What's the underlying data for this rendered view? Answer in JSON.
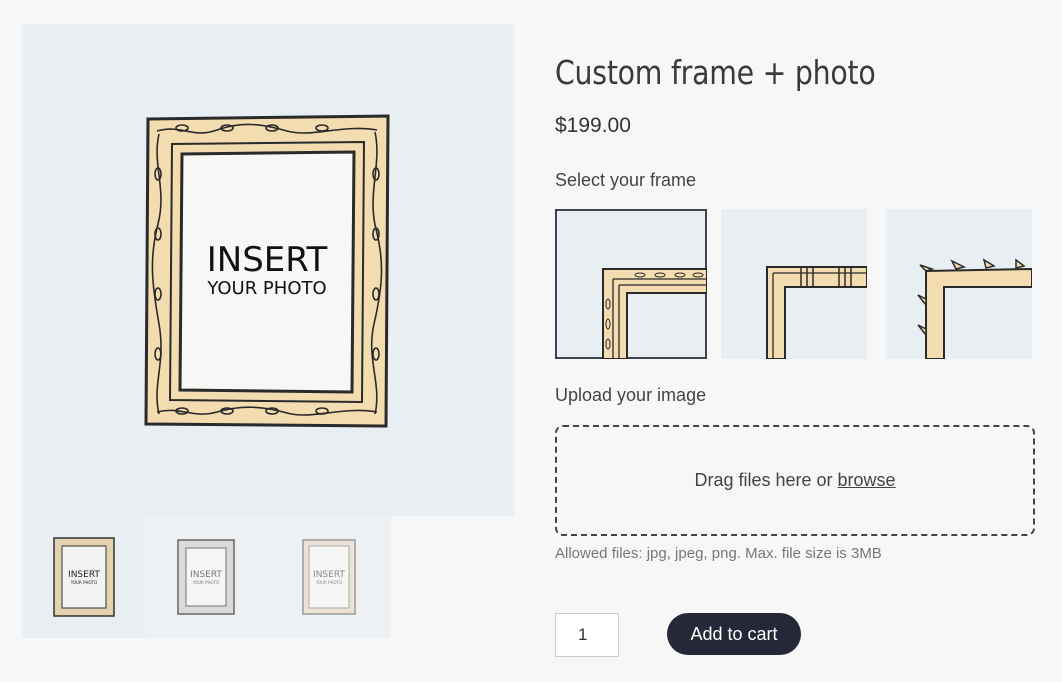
{
  "product": {
    "title": "Custom frame + photo",
    "price": "$199.00"
  },
  "gallery": {
    "main_image": {
      "line1": "INSERT",
      "line2": "YOUR PHOTO",
      "frame_color": "#f3dcb0"
    },
    "thumbnails": [
      {
        "line1": "INSERT",
        "line2": "YOUR PHOTO",
        "frame_color": "#e2d2b0"
      },
      {
        "line1": "INSERT",
        "line2": "YOUR PHOTO",
        "frame_color": "#d9d9d6"
      },
      {
        "line1": "INSERT",
        "line2": "YOUR PHOTO",
        "frame_color": "#ece3d6"
      }
    ]
  },
  "frame_selector": {
    "label": "Select your frame",
    "options": [
      {
        "name": "vine",
        "selected": true
      },
      {
        "name": "block",
        "selected": false
      },
      {
        "name": "leaf",
        "selected": false
      }
    ]
  },
  "upload": {
    "label": "Upload your image",
    "drop_text": "Drag files here or",
    "browse_text": "browse",
    "allowed_text": "Allowed files: jpg, jpeg, png. Max. file size is 3MB"
  },
  "cart": {
    "quantity": "1",
    "add_label": "Add to cart"
  },
  "colors": {
    "background": "#f7f7f7",
    "image_bg": "#e9eef3",
    "button_bg": "#252838",
    "frame_fill": "#f3dcb0",
    "outline": "#2a2a2a"
  }
}
